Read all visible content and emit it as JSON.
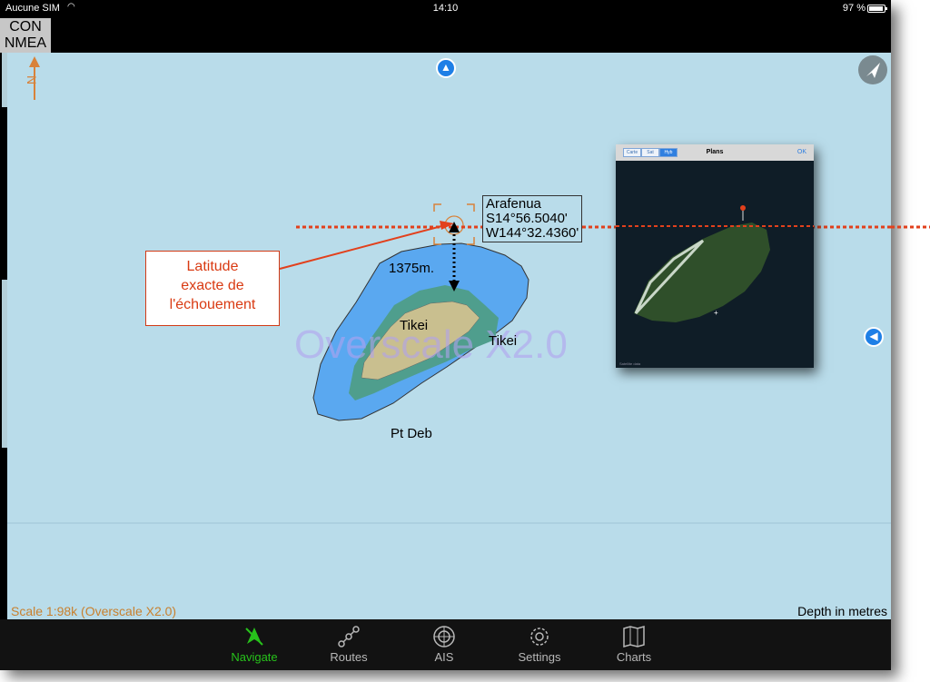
{
  "status_bar": {
    "carrier": "Aucune SIM",
    "time": "14:10",
    "battery": "97 %"
  },
  "top_bar": {
    "con_label_1": "CON",
    "con_label_2": "NMEA",
    "north_label": "N"
  },
  "map": {
    "waypoint": {
      "name": "Arafenua",
      "latitude": "S14°56.5040'",
      "longitude": "W144°32.4360'"
    },
    "distance_label": "1375m.",
    "callout_lines": [
      "Latitude",
      "exacte de",
      "l'échouement"
    ],
    "island_labels": [
      "Tikei",
      "Tikei"
    ],
    "point_label": "Pt Deb",
    "overscale_watermark": "Overscale X2.0",
    "scale_text": "Scale 1:98k (Overscale X2.0)",
    "depth_text": "Depth in metres",
    "colors": {
      "sea": "#b9dcea",
      "shallow": "#5aa8f0",
      "reef": "#4f9e8d",
      "land": "#c9bf8f",
      "latitude_line": "#e2401c",
      "accent": "#1e7fe6"
    }
  },
  "satellite_view": {
    "segments": [
      "Carte",
      "Sat",
      "Hyb"
    ],
    "title": "Plans",
    "ok_label": "OK",
    "credit": "Satellite data"
  },
  "tabs": [
    {
      "label": "Navigate",
      "icon": "navigate-icon",
      "active": true
    },
    {
      "label": "Routes",
      "icon": "routes-icon",
      "active": false
    },
    {
      "label": "AIS",
      "icon": "ais-icon",
      "active": false
    },
    {
      "label": "Settings",
      "icon": "settings-icon",
      "active": false
    },
    {
      "label": "Charts",
      "icon": "charts-icon",
      "active": false
    }
  ]
}
